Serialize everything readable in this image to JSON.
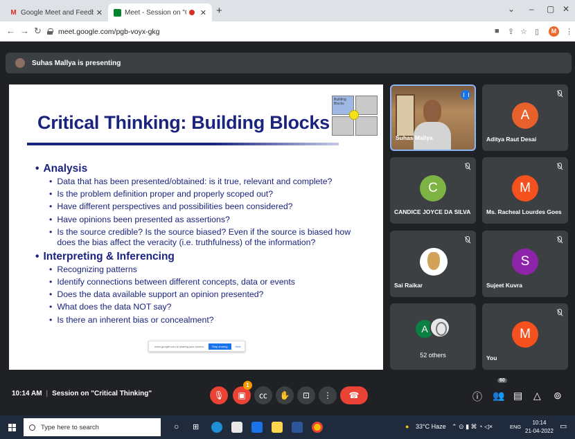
{
  "browser": {
    "tabs": [
      {
        "title": "Google Meet and Feedback Form",
        "favicon": "gmail-icon",
        "active": false
      },
      {
        "title": "Meet - Session on \"Critical Thinking\"",
        "favicon": "meet-icon",
        "active": true
      }
    ],
    "url": "meet.google.com/pgb-voyx-gkg",
    "profile_initial": "M"
  },
  "meet": {
    "presenting_text": "Suhas Mallya is presenting",
    "slide": {
      "title": "Critical Thinking: Building Blocks",
      "logo_text": "Building Blocks",
      "sections": [
        {
          "heading": "Analysis",
          "items": [
            "Data that has been presented/obtained: is it true, relevant and complete?",
            "Is the problem definition proper and properly scoped out?",
            "Have different perspectives and possibilities been considered?",
            "Have opinions been presented as assertions?",
            "Is the source credible? Is the source biased? Even if the source is biased how does the bias affect the veracity (i.e. truthfulness) of the information?"
          ]
        },
        {
          "heading": "Interpreting & Inferencing",
          "items": [
            "Recognizing patterns",
            "Identify connections between different concepts, data or events",
            "Does the data available support an opinion presented?",
            "What does the data NOT say?",
            "Is there an inherent bias or concealment?"
          ]
        }
      ],
      "toast": {
        "text": "meet.google.com is sharing your screen.",
        "stop": "Stop sharing",
        "hide": "Hide"
      }
    },
    "participants": [
      {
        "name": "Suhas Mallya",
        "type": "video"
      },
      {
        "name": "Aditya Raut Desai",
        "initial": "A",
        "color": "#e8602c",
        "muted": true
      },
      {
        "name": "CANDICE JOYCE DA SILVA",
        "initial": "C",
        "color": "#7cb342",
        "muted": true
      },
      {
        "name": "Ms. Racheal Lourdes Goes",
        "initial": "M",
        "color": "#f4511e",
        "muted": true
      },
      {
        "name": "Sai Raikar",
        "type": "image",
        "muted": true
      },
      {
        "name": "Sujeet Kuvra",
        "initial": "S",
        "color": "#8e24aa",
        "muted": true
      },
      {
        "name": "52 others",
        "initial": "A",
        "type": "group"
      },
      {
        "name": "You",
        "initial": "M",
        "color": "#f4511e",
        "muted": true
      }
    ],
    "bottom": {
      "time": "10:14 AM",
      "meeting_title": "Session on \"Critical Thinking\"",
      "reactions_badge": "1",
      "participant_count": "60"
    }
  },
  "taskbar": {
    "search_placeholder": "Type here to search",
    "weather": "33°C Haze",
    "language": "ENG",
    "time": "10:14",
    "date": "21-04-2022"
  }
}
